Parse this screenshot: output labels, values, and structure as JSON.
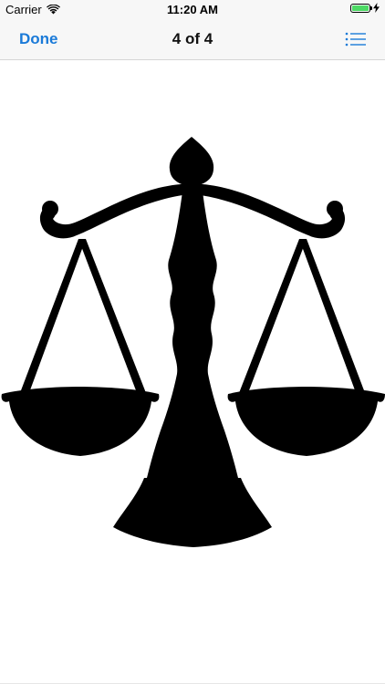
{
  "status_bar": {
    "carrier": "Carrier",
    "time": "11:20 AM",
    "battery_level": 1.0,
    "charging": true,
    "battery_color": "#4cd964"
  },
  "nav": {
    "done_label": "Done",
    "title": "4 of 4",
    "list_icon": "list-icon",
    "accent_color": "#1a7ad8"
  },
  "content": {
    "image_icon": "scales-of-justice-icon"
  }
}
